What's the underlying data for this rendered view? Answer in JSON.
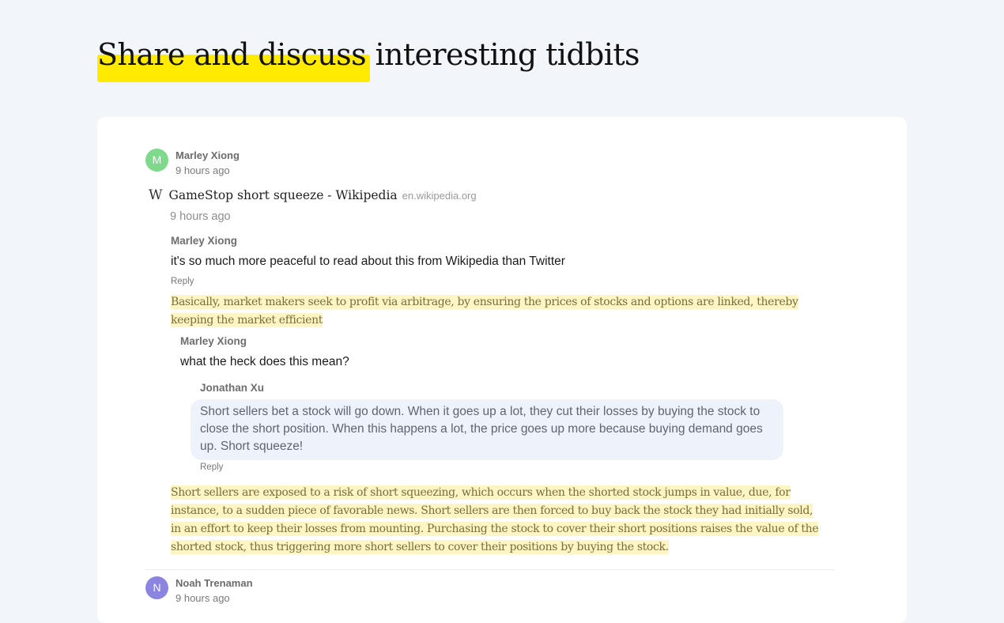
{
  "headline": {
    "highlighted": "Share and discuss",
    "rest": " interesting tidbits"
  },
  "post": {
    "author_initial": "M",
    "author": "Marley Xiong",
    "time": "9 hours ago",
    "link": {
      "icon": "W",
      "title": "GameStop short squeeze - Wikipedia",
      "domain": "en.wikipedia.org",
      "time": "9 hours ago"
    },
    "comment1": {
      "author": "Marley Xiong",
      "text": "it's so much more peaceful to read about this from Wikipedia than Twitter",
      "reply": "Reply"
    },
    "quote1": "Basically, market makers seek to profit via arbitrage, by ensuring the prices of stocks and options are linked, thereby keeping the market efficient",
    "comment2": {
      "author": "Marley Xiong",
      "text": "what the heck does this mean?"
    },
    "comment3": {
      "author": "Jonathan Xu",
      "text": "Short sellers bet a stock will go down. When it goes up a lot, they cut their losses by buying the stock to close the short position. When this happens a lot, the price goes up more because buying demand goes up. Short squeeze!",
      "reply": "Reply"
    },
    "quote2": "Short sellers are exposed to a risk of short squeezing, which occurs when the shorted stock jumps in value, due, for instance, to a sudden piece of favorable news. Short sellers are then forced to buy back the stock they had initially sold, in an effort to keep their losses from mounting. Purchasing the stock to cover their short positions raises the value of the shorted stock, thus triggering more short sellers to cover their positions by buying the stock."
  },
  "post2": {
    "author_initial": "N",
    "author": "Noah Trenaman",
    "time": "9 hours ago"
  },
  "colors": {
    "highlight": "#ffea00",
    "avatar_m": "#7fd98c",
    "avatar_n": "#8b84e0",
    "quote_bg": "#fdf5c4",
    "bubble_bg": "#eef2fb"
  }
}
